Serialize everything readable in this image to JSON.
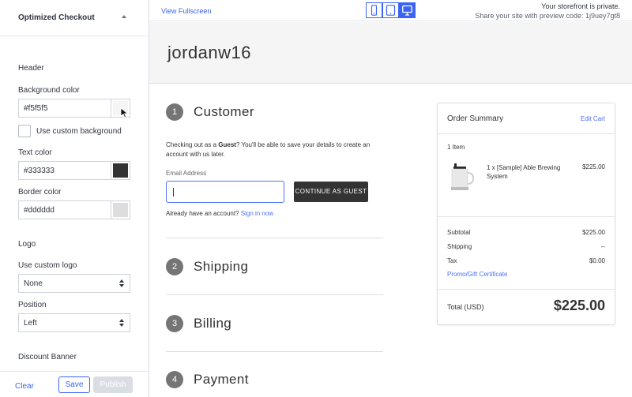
{
  "sidebar": {
    "section_title": "Optimized Checkout",
    "header_label": "Header",
    "background_color_label": "Background color",
    "background_color_value": "#f5f5f5",
    "use_custom_background_label": "Use custom background",
    "text_color_label": "Text color",
    "text_color_value": "#333333",
    "border_color_label": "Border color",
    "border_color_value": "#dddddd",
    "logo_label": "Logo",
    "use_custom_logo_label": "Use custom logo",
    "use_custom_logo_value": "None",
    "position_label": "Position",
    "position_value": "Left",
    "discount_banner_label": "Discount Banner",
    "clear_label": "Clear",
    "save_label": "Save",
    "publish_label": "Publish"
  },
  "topbar": {
    "view_fullscreen": "View Fullscreen",
    "private_notice": "Your storefront is private.",
    "preview_code": "Share your site with preview code: 1j9uey7gt8",
    "devices": [
      "phone-icon",
      "tablet-icon",
      "desktop-icon"
    ],
    "active_device": "desktop"
  },
  "store": {
    "store_name": "jordanw16",
    "steps": [
      {
        "num": "1",
        "title": "Customer"
      },
      {
        "num": "2",
        "title": "Shipping"
      },
      {
        "num": "3",
        "title": "Billing"
      },
      {
        "num": "4",
        "title": "Payment"
      }
    ],
    "guest_prefix": "Checking out as a ",
    "guest_bold": "Guest",
    "guest_suffix": "? You'll be able to save your details to create an account with us later.",
    "email_label": "Email Address",
    "continue_button": "CONTINUE AS GUEST",
    "have_account": "Already have an account?",
    "sign_in": "Sign in now"
  },
  "summary": {
    "title": "Order Summary",
    "edit_cart": "Edit Cart",
    "item_count": "1 Item",
    "product_name": "1 x [Sample] Able Brewing System",
    "product_price": "$225.00",
    "subtotal_label": "Subtotal",
    "subtotal_value": "$225.00",
    "shipping_label": "Shipping",
    "shipping_value": "--",
    "tax_label": "Tax",
    "tax_value": "$0.00",
    "promo": "Promo/Gift Certificate",
    "total_label": "Total (USD)",
    "total_value": "$225.00"
  },
  "colors": {
    "accent": "#3c64f4",
    "link": "#4b71fc",
    "header_bg": "#f5f5f5",
    "text": "#333333",
    "border": "#dddddd"
  }
}
